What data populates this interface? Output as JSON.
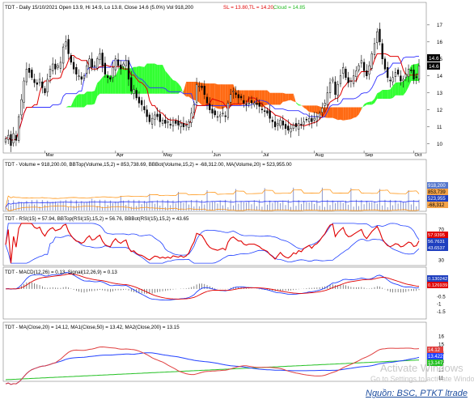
{
  "chart_data": [
    {
      "type": "candlestick",
      "title": "TDT - Daily 15/10/2021 Open 13.9, Hi 14.9, Lo 13.8, Close 14.6 (5.0%) Vol 918,200",
      "title_parts": {
        "main": "TDT - Daily 15/10/2021 Open 13.9, Hi 14.9, Lo 13.8, Close 14.6 (5.0%) Vol 918,200",
        "sl": "SL = 13.80,",
        "tl": "TL = 14.20,",
        "cloud": "Cloud = 14.85"
      },
      "x_labels": [
        "Mar",
        "Apr",
        "May",
        "Jun",
        "Jul",
        "Aug",
        "Sep",
        "Oct"
      ],
      "y_ticks": [
        10,
        11,
        12,
        13,
        14,
        15,
        16,
        17
      ],
      "ylim": [
        9.6,
        17.8
      ],
      "right_labels": [
        "14.6",
        "14.6"
      ],
      "close": [
        10.3,
        10.5,
        9.9,
        10.6,
        10.2,
        11.6,
        12.6,
        13.7,
        14.4,
        14.2,
        13.9,
        13.6,
        13.5,
        13.8,
        13.3,
        13.0,
        13.8,
        14.4,
        14.7,
        14.4,
        14.6,
        14.8,
        15.7,
        16.0,
        15.3,
        14.8,
        14.4,
        14.1,
        14.0,
        13.8,
        14.0,
        14.6,
        15.0,
        14.5,
        14.6,
        15.0,
        15.3,
        14.6,
        14.1,
        13.9,
        13.8,
        14.5,
        15.0,
        14.6,
        14.4,
        14.7,
        14.9,
        13.8,
        13.1,
        13.2,
        12.7,
        12.4,
        12.3,
        12.0,
        11.6,
        11.3,
        11.5,
        11.7,
        11.6,
        11.3,
        11.4,
        11.2,
        11.3,
        11.1,
        11.3,
        11.2,
        11.1,
        11.2,
        11.0,
        11.1,
        11.3,
        11.8,
        12.3,
        13.5,
        13.4,
        13.3,
        12.9,
        12.4,
        12.0,
        11.8,
        11.7,
        11.6,
        11.7,
        11.8,
        11.6,
        12.4,
        12.9,
        13.1,
        12.9,
        12.7,
        12.7,
        12.4,
        12.3,
        12.4,
        12.4,
        12.4,
        12.3,
        12.2,
        12.0,
        11.9,
        11.8,
        11.5,
        11.3,
        11.0,
        11.2,
        11.4,
        11.1,
        10.9,
        10.8,
        10.9,
        11.1,
        11.0,
        11.2,
        11.1,
        11.3,
        11.4,
        11.5,
        11.3,
        11.5,
        11.6,
        11.8,
        12.1,
        12.4,
        13.0,
        13.6,
        13.8,
        12.9,
        13.5,
        14.0,
        14.5,
        13.9,
        13.6,
        13.7,
        14.0,
        14.3,
        14.6,
        14.9,
        14.3,
        14.0,
        14.6,
        15.3,
        15.9,
        16.6,
        16.0,
        15.0,
        14.4,
        13.9,
        13.7,
        13.9,
        14.2,
        14.1,
        13.7,
        13.8,
        14.1,
        14.4,
        14.3,
        13.8,
        13.9,
        14.6
      ]
    },
    {
      "type": "bar",
      "title": "TDT - Volume = 918,200.00, BBTop(Volume,15,2) = 853,738.69, BBBot(Volume,15,2) = -68,312.00, MA(Volume,20) = 523,955.00",
      "right_labels": [
        "918,200",
        "853,739",
        "523,955",
        "-68,312"
      ]
    },
    {
      "type": "line",
      "title": "TDT - RSI(15) = 57.94, BBTop(RSI(15),15,2) = 56.76, BBBot(RSI(15),15,2) = 43.65",
      "y_ticks": [
        30,
        50,
        70
      ],
      "ylim": [
        25,
        80
      ],
      "right_labels": [
        "57.9395",
        "56.7631",
        "43.6537"
      ]
    },
    {
      "type": "line",
      "title": "TDT - MACD(12,26) = 0.13, Signal(12,26,9) = 0.13",
      "y_ticks": [
        -1.5,
        -1,
        -0.5
      ],
      "ylim": [
        -1.9,
        0.8
      ],
      "right_labels": [
        "0.130242",
        "0.126939"
      ]
    },
    {
      "type": "line",
      "title": "TDT - MA(Close,20) = 14.12, MA1(Close,50) = 13.42, MA2(Close,200) = 13.15",
      "y_ticks": [
        11,
        12,
        13,
        14,
        15,
        16
      ],
      "ylim": [
        10.7,
        16.5
      ],
      "right_labels": [
        "14.12",
        "13.422",
        "13.147"
      ]
    }
  ],
  "watermark": {
    "line1": "Activate Windows",
    "line2": "Go to Settings to activate Windows."
  },
  "source": "Nguồn: BSC, PTKT ltrade",
  "colors": {
    "up": "#000000",
    "cloud_bull": "#33ff33",
    "cloud_bear": "#ff6a13",
    "tenkan": "#e00000",
    "kijun": "#3030ff",
    "ma20": "#e04040",
    "ma50": "#2040ff",
    "ma200": "#22c022",
    "bbtop": "#ff8c00"
  }
}
